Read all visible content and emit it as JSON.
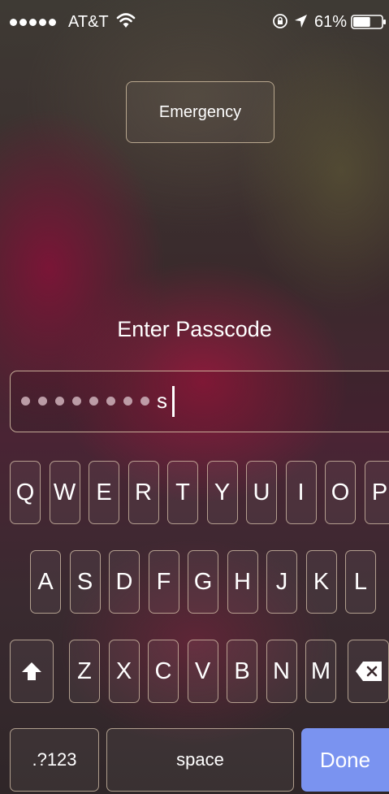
{
  "status_bar": {
    "carrier": "AT&T",
    "battery_percent": "61%",
    "battery_level": 0.61,
    "signal_bars": 5,
    "icons": [
      "wifi-icon",
      "orientation-lock-icon",
      "location-arrow-icon",
      "battery-icon"
    ]
  },
  "emergency_label": "Emergency",
  "passcode": {
    "prompt": "Enter Passcode",
    "masked_count": 8,
    "typed_char": "s"
  },
  "keyboard": {
    "row1": [
      "Q",
      "W",
      "E",
      "R",
      "T",
      "Y",
      "U",
      "I",
      "O",
      "P"
    ],
    "row2": [
      "A",
      "S",
      "D",
      "F",
      "G",
      "H",
      "J",
      "K",
      "L"
    ],
    "row3": [
      "Z",
      "X",
      "C",
      "V",
      "B",
      "N",
      "M"
    ],
    "numbers_label": ".?123",
    "space_label": "space",
    "done_label": "Done",
    "done_color": "#7a93f0"
  }
}
